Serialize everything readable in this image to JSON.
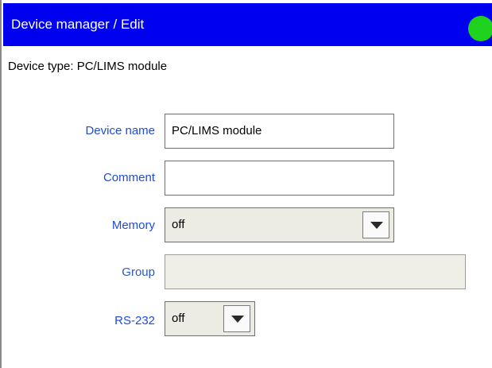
{
  "window": {
    "title": "Device manager / Edit",
    "status_color": "#1ed21e",
    "status_icon": "status-indicator-icon"
  },
  "device_type_text": "Device type: PC/LIMS module",
  "form": {
    "device_name": {
      "label": "Device name",
      "value": "PC/LIMS module"
    },
    "comment": {
      "label": "Comment",
      "value": ""
    },
    "memory": {
      "label": "Memory",
      "value": "off"
    },
    "group": {
      "label": "Group",
      "value": ""
    },
    "rs232": {
      "label": "RS-232",
      "value": "off"
    }
  },
  "colors": {
    "titlebar": "#0000f0",
    "label": "#1f4bd8"
  }
}
